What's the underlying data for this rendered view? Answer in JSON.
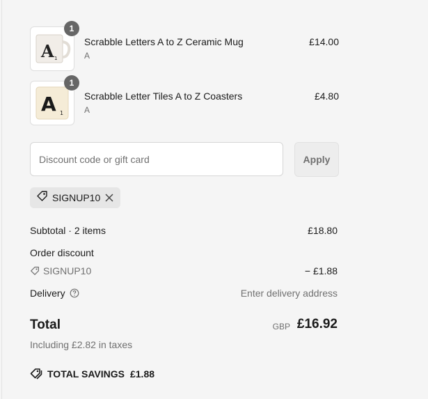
{
  "cart": {
    "items": [
      {
        "name": "Scrabble Letters A to Z Ceramic Mug",
        "variant": "A",
        "price": "£14.00",
        "quantity": "1"
      },
      {
        "name": "Scrabble Letter Tiles A to Z Coasters",
        "variant": "A",
        "price": "£4.80",
        "quantity": "1"
      }
    ]
  },
  "discount": {
    "placeholder": "Discount code or gift card",
    "apply_label": "Apply",
    "applied_code": "SIGNUP10"
  },
  "summary": {
    "subtotal_label": "Subtotal · 2 items",
    "subtotal_value": "£18.80",
    "order_discount_label": "Order discount",
    "discount_code": "SIGNUP10",
    "discount_value": "− £1.88",
    "delivery_label": "Delivery",
    "delivery_value": "Enter delivery address",
    "total_label": "Total",
    "currency": "GBP",
    "total_value": "£16.92",
    "taxes_note": "Including £2.82 in taxes",
    "savings_label": "TOTAL SAVINGS",
    "savings_value": "£1.88"
  },
  "colors": {
    "background": "#f5f5f5",
    "text": "#1a1a1a",
    "muted": "#707070",
    "badge": "#666666"
  }
}
